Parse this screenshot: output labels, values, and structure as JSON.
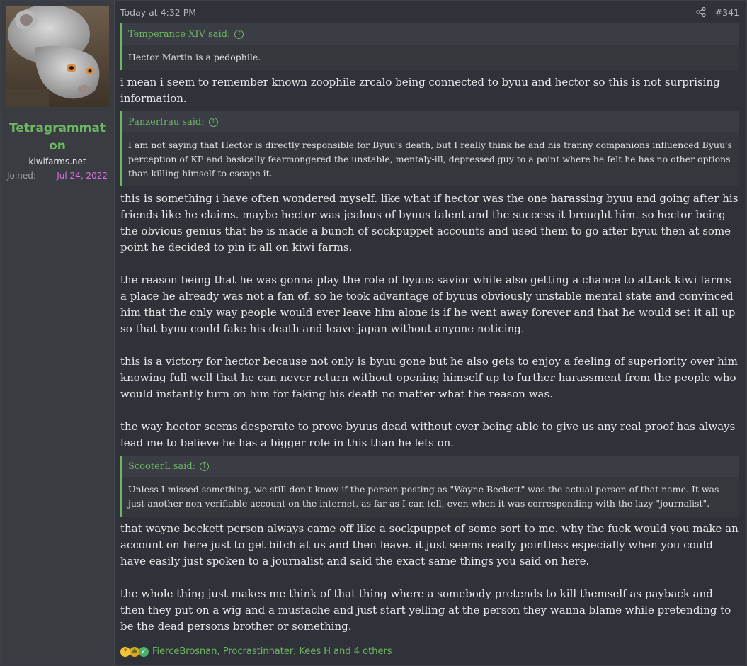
{
  "user": {
    "name": "Tetragrammaton",
    "title": "kiwifarms.net",
    "joined_label": "Joined:",
    "joined_value": "Jul 24, 2022"
  },
  "post": {
    "timestamp": "Today at 4:32 PM",
    "number": "#341"
  },
  "quotes": [
    {
      "author": "Temperance XIV said:",
      "body": "Hector Martin is a pedophile."
    },
    {
      "author": "Panzerfrau said:",
      "body": "I am not saying that Hector is directly responsible for Byuu's death, but I really think he and his tranny companions influenced Byuu's perception of KF and basically fearmongered the unstable, mentaly-ill, depressed guy to a point where he felt he has no other options than killing himself to escape it."
    },
    {
      "author": "ScooterL said:",
      "body": "Unless I missed something, we still don't know if the person posting as \"Wayne Beckett\" was the actual person of that name. It was just another non-verifiable account on the internet, as far as I can tell, even when it was corresponding with the lazy \"journalist\"."
    }
  ],
  "replies": {
    "r1": "i mean i seem to remember known zoophile zrcalo being connected to byuu and hector so this is not surprising information.",
    "r2_p1": "this is something i have often wondered myself. like what if hector was the one harassing byuu and going after his friends like he claims. maybe hector was jealous of byuus talent and the success it brought him. so hector being the obvious genius that he is made a bunch of sockpuppet accounts and used them to go after byuu then at some point he decided to pin it all on kiwi farms.",
    "r2_p2": "the reason being that he was gonna play the role of byuus savior while also getting a chance to attack kiwi farms a place he already was not a fan of. so he took advantage of byuus obviously unstable mental state and convinced him that the only way people would ever leave him alone is if he went away forever and that he would set it all up so that byuu could fake his death and leave japan without anyone noticing.",
    "r2_p3": "this is a victory for hector because not only is byuu gone but he also gets to enjoy a feeling of superiority over him knowing full well that he can never return without opening himself up to further harassment from the people who would instantly turn on him for faking his death no matter what the reason was.",
    "r2_p4": "the way hector seems desperate to prove byuus dead without ever being able to give us any real proof has always lead me to believe he has a bigger role in this than he lets on.",
    "r3_p1": "that wayne beckett person always came off like a sockpuppet of some sort to me. why the fuck would you make an account on here just to get bitch at us and then leave. it just seems really pointless especially when you could have easily just spoken to a journalist and said the exact same things you said on here.",
    "r3_p2": "the whole thing just makes me think of that thing where a somebody pretends to kill themself as payback and then they put on a wig and a mustache and just start yelling at the person they wanna blame while pretending to be the dead persons brother or something."
  },
  "reactions": {
    "icons": [
      "thinking-face-icon",
      "pineapple-icon",
      "check-icon"
    ],
    "text": "FierceBrosnan, Procrastinhater, Kees H and 4 others"
  },
  "colors": {
    "accent_green": "#6fb764",
    "joined_pink": "#e26ee6",
    "background": "#2f3238"
  }
}
